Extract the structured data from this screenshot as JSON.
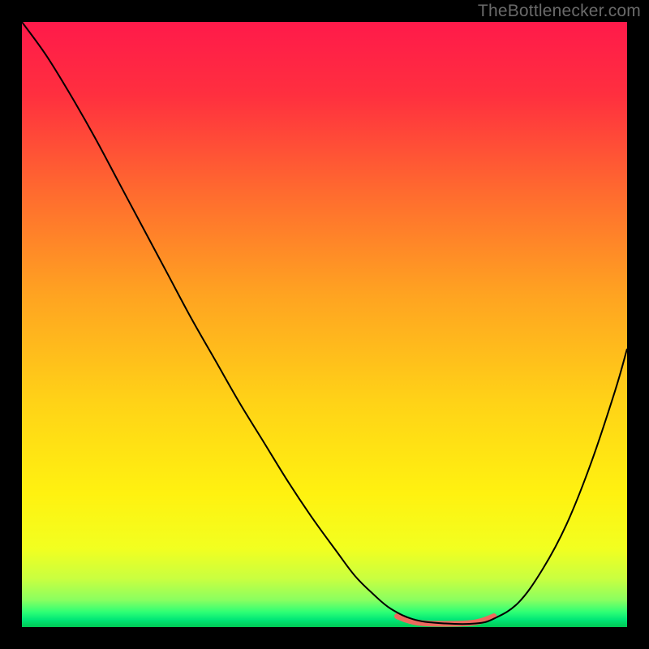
{
  "watermark": "TheBottlenecker.com",
  "chart_data": {
    "type": "line",
    "title": "",
    "xlabel": "",
    "ylabel": "",
    "xlim": [
      0,
      100
    ],
    "ylim": [
      0,
      100
    ],
    "grid": false,
    "gradient_stops": [
      {
        "offset": 0.0,
        "color": "#ff1a4a"
      },
      {
        "offset": 0.12,
        "color": "#ff2f3f"
      },
      {
        "offset": 0.28,
        "color": "#ff6a2f"
      },
      {
        "offset": 0.45,
        "color": "#ffa321"
      },
      {
        "offset": 0.63,
        "color": "#ffd317"
      },
      {
        "offset": 0.78,
        "color": "#fff210"
      },
      {
        "offset": 0.87,
        "color": "#f2ff20"
      },
      {
        "offset": 0.92,
        "color": "#c9ff40"
      },
      {
        "offset": 0.955,
        "color": "#8aff60"
      },
      {
        "offset": 0.975,
        "color": "#2fff75"
      },
      {
        "offset": 0.988,
        "color": "#00e676"
      },
      {
        "offset": 1.0,
        "color": "#00c853"
      }
    ],
    "series": [
      {
        "name": "bottleneck-curve",
        "color": "#000000",
        "width": 2,
        "x": [
          0,
          4,
          8,
          12,
          16,
          20,
          24,
          28,
          32,
          36,
          40,
          44,
          48,
          52,
          55,
          58,
          61,
          65,
          70,
          75,
          78,
          82,
          86,
          90,
          94,
          98,
          100
        ],
        "y": [
          100,
          94.5,
          88.0,
          81.0,
          73.5,
          66.0,
          58.5,
          51.0,
          44.0,
          37.0,
          30.5,
          24.0,
          18.0,
          12.5,
          8.5,
          5.5,
          3.0,
          1.2,
          0.6,
          0.6,
          1.4,
          4.0,
          9.5,
          17.0,
          27.0,
          39.0,
          46.0
        ]
      },
      {
        "name": "flat-minimum",
        "color": "#ed6a5e",
        "width": 7,
        "linecap": "round",
        "x": [
          62,
          63.5,
          65,
          67,
          69,
          71,
          73,
          75,
          76.5,
          78
        ],
        "y": [
          1.8,
          1.2,
          0.8,
          0.6,
          0.55,
          0.55,
          0.6,
          0.8,
          1.2,
          1.8
        ]
      }
    ]
  }
}
